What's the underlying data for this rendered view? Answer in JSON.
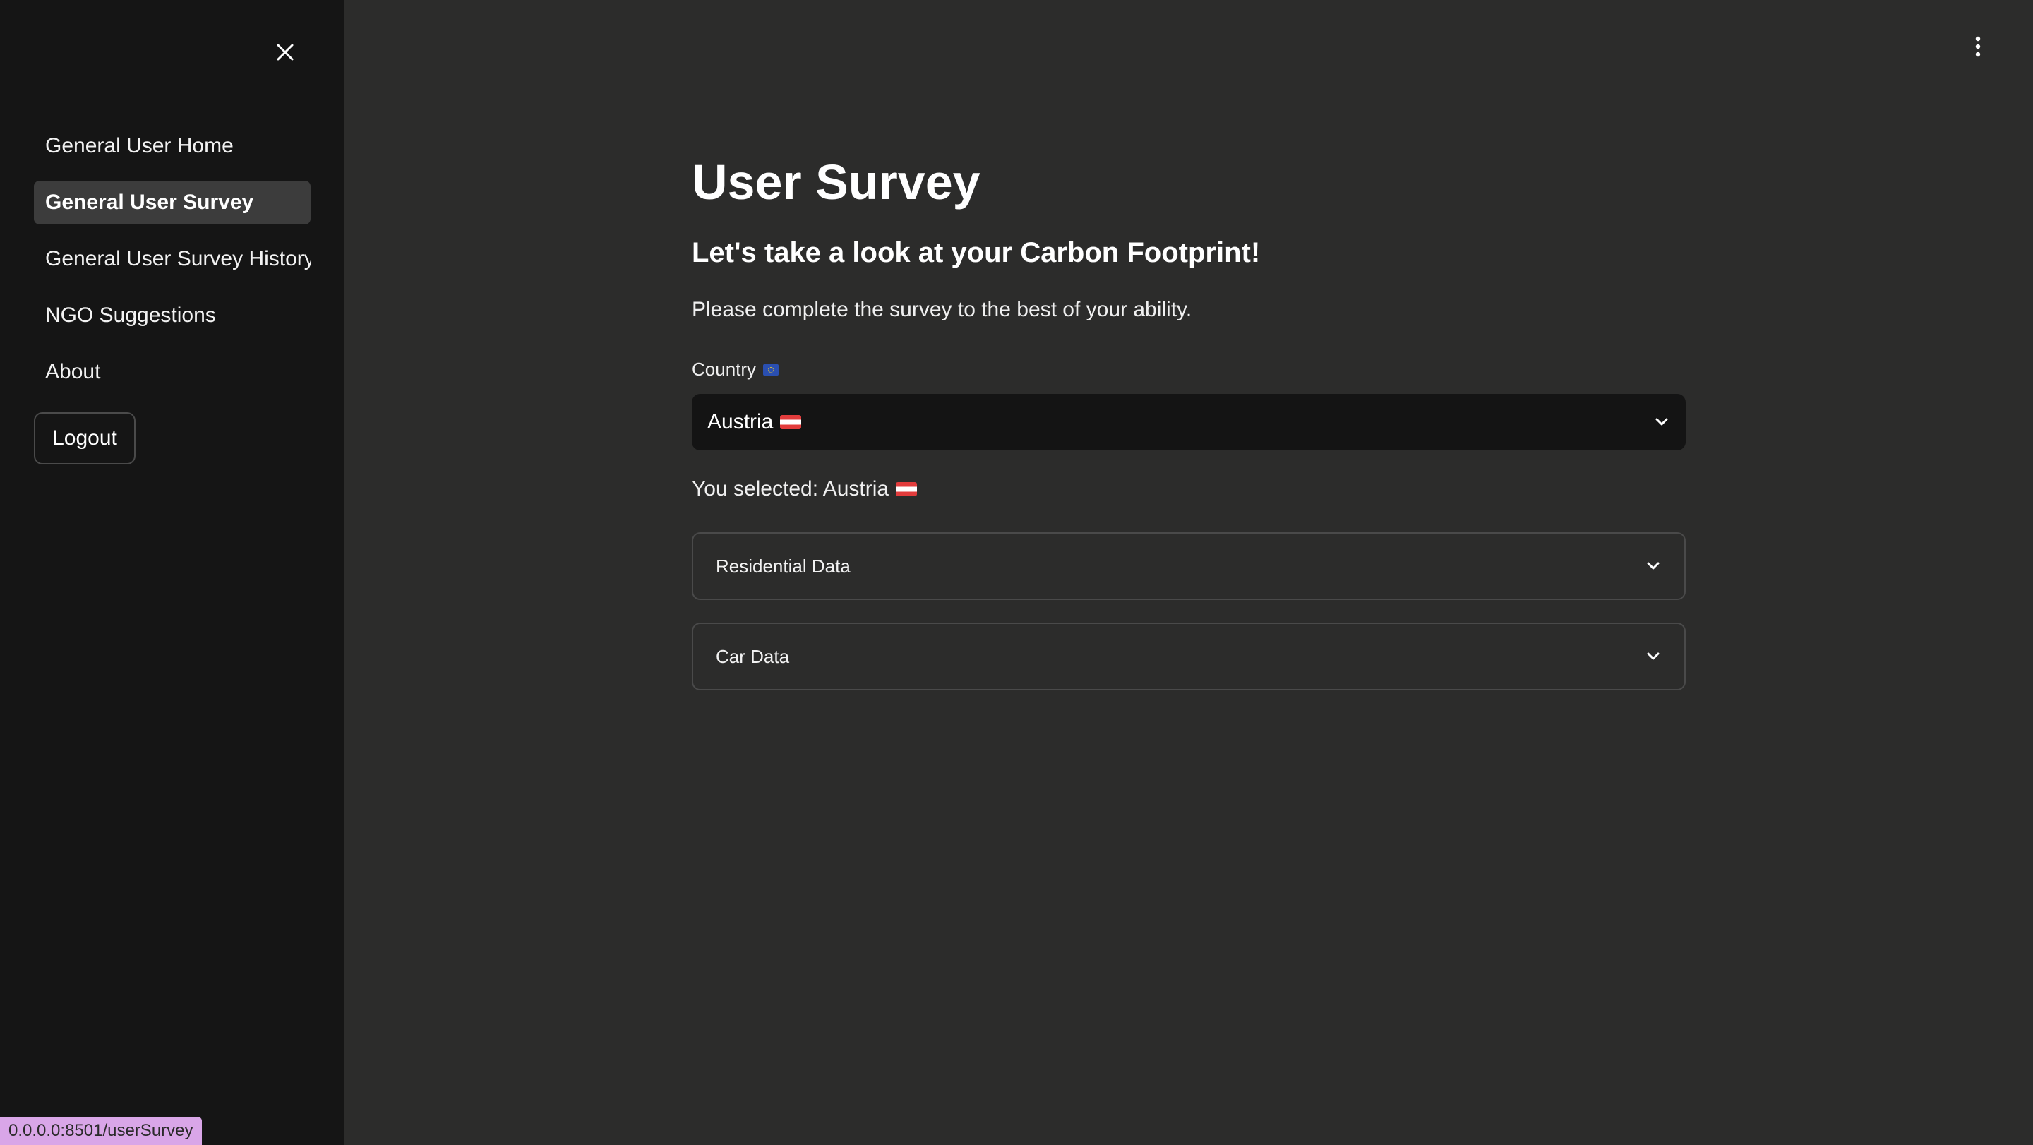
{
  "sidebar": {
    "items": [
      {
        "label": "General User Home",
        "active": false
      },
      {
        "label": "General User Survey",
        "active": true
      },
      {
        "label": "General User Survey History",
        "active": false
      },
      {
        "label": "NGO Suggestions",
        "active": false
      },
      {
        "label": "About",
        "active": false
      }
    ],
    "logout_label": "Logout",
    "close_icon": "close-icon"
  },
  "status_bar": {
    "url": "0.0.0.0:8501/userSurvey"
  },
  "main": {
    "title": "User Survey",
    "subtitle": "Let's take a look at your Carbon Footprint!",
    "intro": "Please complete the survey to the best of your ability.",
    "country_field": {
      "label": "Country",
      "label_icon": "eu-flag-icon",
      "value": "Austria",
      "value_icon": "austria-flag-icon"
    },
    "selected_text": "You selected: Austria",
    "expanders": [
      {
        "label": "Residential Data"
      },
      {
        "label": "Car Data"
      }
    ]
  },
  "colors": {
    "background": "#2c2c2b",
    "sidebar": "#151515",
    "select_bg": "#141414",
    "active_nav": "#3c3c3c",
    "status_bar": "#d9a6e8"
  }
}
